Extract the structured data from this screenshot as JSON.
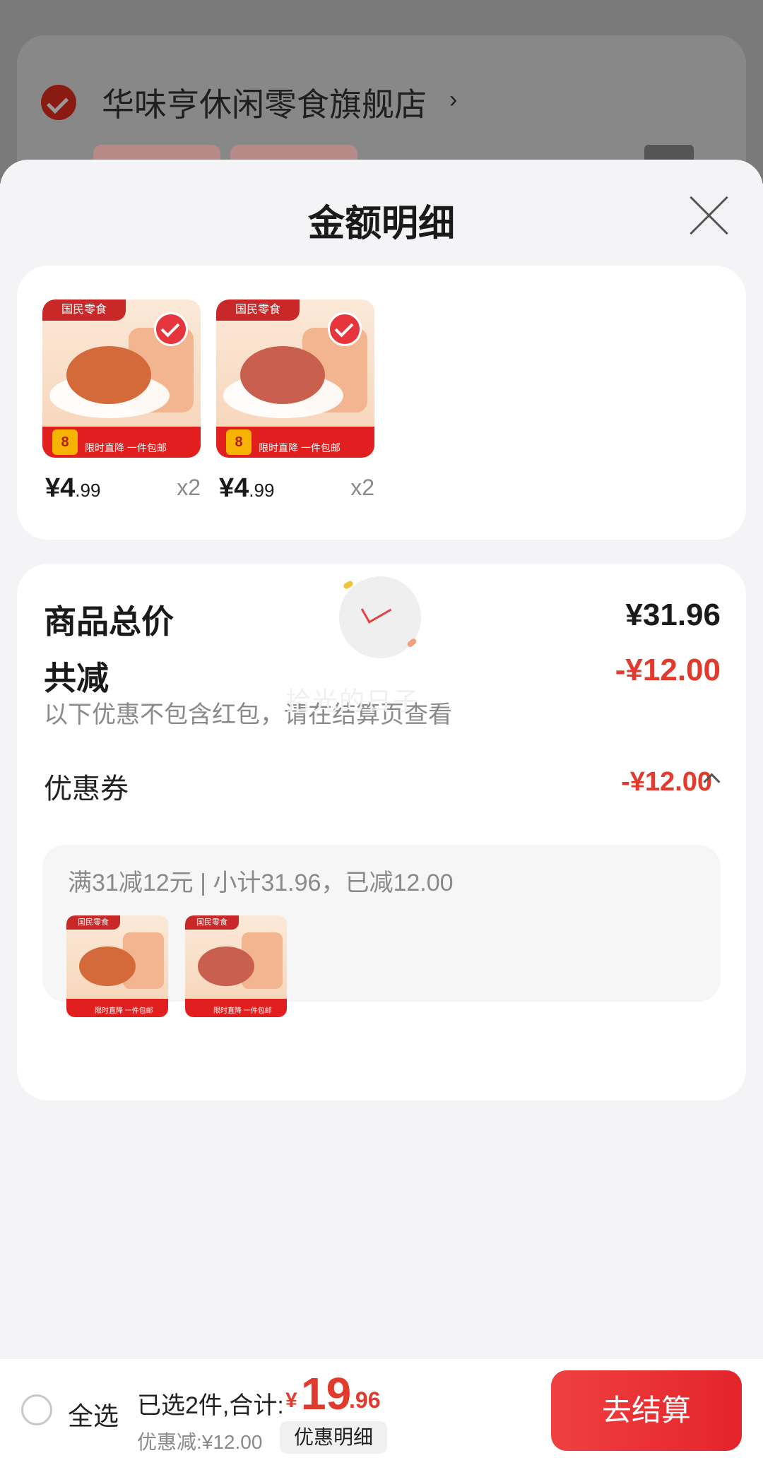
{
  "background": {
    "store_name": "华味亨休闲零食旗舰店",
    "chevron": "›"
  },
  "sheet": {
    "title": "金额明细",
    "close_icon": "close-icon"
  },
  "products": [
    {
      "brand": "国民零食",
      "price_int": "¥4",
      "price_dec": ".99",
      "qty": "x2",
      "promo": "限时直降 一件包邮",
      "badge": "8",
      "food_color": "#d46a3a"
    },
    {
      "brand": "国民零食",
      "price_int": "¥4",
      "price_dec": ".99",
      "qty": "x2",
      "promo": "限时直降 一件包邮",
      "badge": "8",
      "food_color": "#c9604f"
    }
  ],
  "summary": {
    "total_label": "商品总价",
    "total_value": "¥31.96",
    "discount_label": "共减",
    "discount_value": "-¥12.00",
    "discount_note": "以下优惠不包含红包，请在结算页查看",
    "coupon_label": "优惠券",
    "coupon_value": "-¥12.00",
    "coupon_desc": "满31减12元 | 小计31.96，已减12.00",
    "mini_brand": "国民零食",
    "mini_promo": "限时直降 一件包邮"
  },
  "watermark": "拾光的日子",
  "bottom": {
    "select_all": "全选",
    "selected_info": "已选2件,合计:",
    "total_symbol": "¥",
    "total_int": "19",
    "total_dec": ".96",
    "discount": "优惠减:¥12.00",
    "detail_button": "优惠明细",
    "checkout_button": "去结算"
  },
  "colors": {
    "accent": "#e23a2c",
    "checkout": "#e3242a"
  }
}
